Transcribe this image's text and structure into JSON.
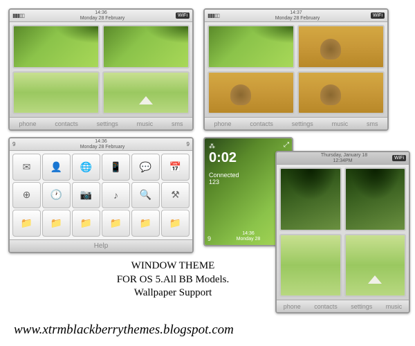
{
  "screens": {
    "s1": {
      "date": "Monday 28 February",
      "time": "14:36",
      "wifi": "WiFi",
      "dock": [
        "phone",
        "contacts",
        "settings",
        "music",
        "sms"
      ]
    },
    "s2": {
      "date": "Monday 28 February",
      "time": "14:37",
      "wifi": "WiFi",
      "dock": [
        "phone",
        "contacts",
        "settings",
        "music",
        "sms"
      ]
    },
    "s3": {
      "date": "Monday 28 February",
      "time": "14:36",
      "left_num": "9",
      "right_num": "9",
      "help": "Help"
    },
    "s4": {
      "time": "0:02",
      "status": "Connected",
      "sub": "123",
      "date_time": "14:36",
      "date": "Monday 28",
      "left_num": "9"
    },
    "s5": {
      "date": "Thursday, January 18",
      "time": "12:34PM",
      "wifi": "WiFi",
      "dock": [
        "phone",
        "contacts",
        "settings",
        "music"
      ]
    }
  },
  "title": {
    "line1": "WINDOW THEME",
    "line2": "FOR OS 5.All BB Models.",
    "line3": "Wallpaper Support"
  },
  "url": "www.xtrmblackberrythemes.blogspot.com"
}
